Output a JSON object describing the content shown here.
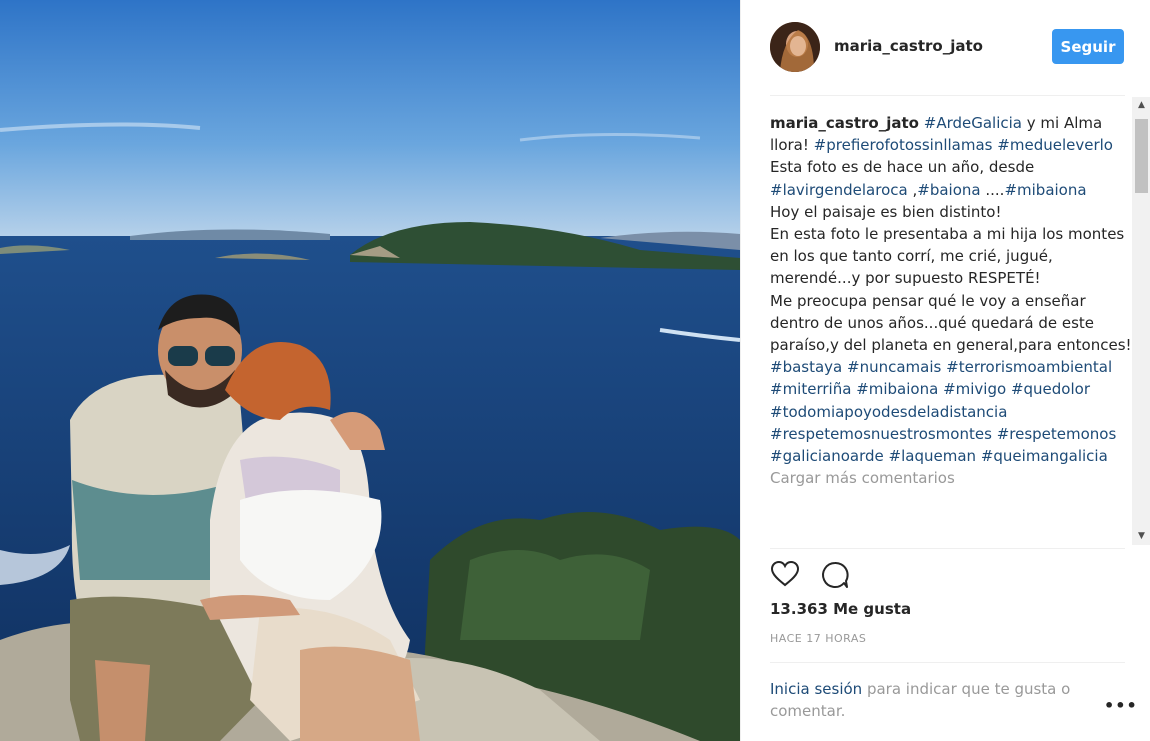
{
  "post": {
    "username": "maria_castro_jato",
    "follow_label": "Seguir",
    "caption": {
      "author": "maria_castro_jato",
      "tags_line1": [
        "#ArdeGalicia"
      ],
      "text1": "y mi Alma llora!",
      "tags_line2": [
        "#prefierofotossinllamas",
        "#medueleverlo"
      ],
      "text2": "Esta foto es de hace un año, desde",
      "tag_lavirgen": "#lavirgendelaroca",
      "text_comma": ",",
      "tag_baiona": "#baiona",
      "text_dots": "....",
      "tag_mibaiona": "#mibaiona",
      "text3": "Hoy el paisaje es bien distinto!",
      "text4": "En esta foto le presentaba a mi hija los montes en los que tanto corrí, me crié, jugué, merendé...y por supuesto RESPETÉ!",
      "text5": "Me preocupa pensar qué le voy a enseñar dentro de unos años...qué quedará de este paraíso,y del planeta en general,para entonces!",
      "final_tags": [
        "#bastaya",
        "#nuncamais",
        "#terrorismoambiental",
        "#miterriña",
        "#mibaiona",
        "#mivigo",
        "#quedolor",
        "#todomiapoyodesdeladistancia",
        "#respetemosnuestrosmontes",
        "#respetemonos",
        "#galicianoarde",
        "#laqueman",
        "#queimangalicia"
      ]
    },
    "load_more": "Cargar más comentarios",
    "icons": {
      "like": "heart-icon",
      "comment": "comment-icon",
      "more": "more-options-icon"
    },
    "likes": "13.363 Me gusta",
    "time": "HACE 17 HORAS",
    "login_link": "Inicia sesión",
    "login_text": "para indicar que te gusta o comentar.",
    "more_options": "•••",
    "colors": {
      "accent": "#3897f0",
      "hashtag": "#1e4b77",
      "muted": "#999999"
    }
  }
}
